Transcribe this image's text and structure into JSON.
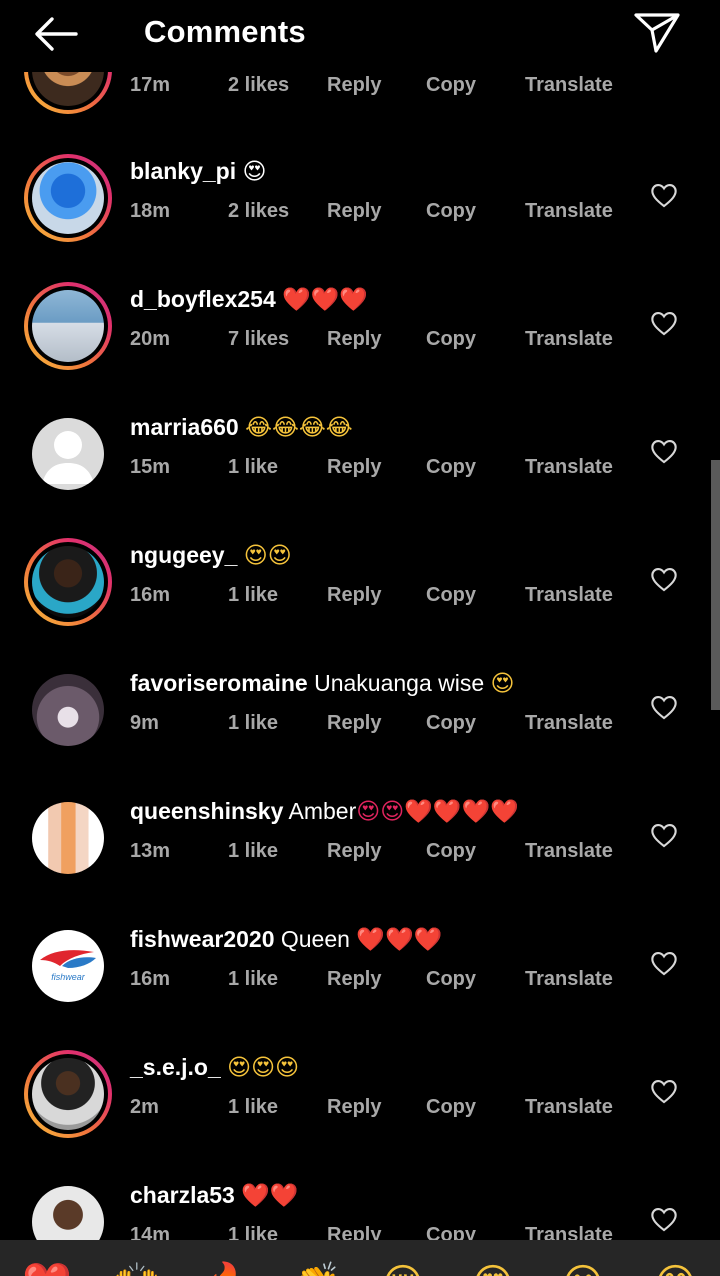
{
  "header": {
    "title": "Comments"
  },
  "comments": [
    {
      "username": "",
      "text": "",
      "emoji": "",
      "time": "17m",
      "likes": "2 likes",
      "reply": "Reply",
      "copy": "Copy",
      "translate": "Translate"
    },
    {
      "username": "blanky_pi",
      "text": "",
      "emoji": "😍",
      "time": "18m",
      "likes": "2 likes",
      "reply": "Reply",
      "copy": "Copy",
      "translate": "Translate"
    },
    {
      "username": "d_boyflex254",
      "text": "",
      "emoji": "❤️❤️❤️",
      "time": "20m",
      "likes": "7 likes",
      "reply": "Reply",
      "copy": "Copy",
      "translate": "Translate"
    },
    {
      "username": "marria660",
      "text": "",
      "emoji": "😂😂😂😂",
      "time": "15m",
      "likes": "1 like",
      "reply": "Reply",
      "copy": "Copy",
      "translate": "Translate"
    },
    {
      "username": "ngugeey_",
      "text": "",
      "emoji": "😍😍",
      "time": "16m",
      "likes": "1 like",
      "reply": "Reply",
      "copy": "Copy",
      "translate": "Translate"
    },
    {
      "username": "favoriseromaine",
      "text": "Unakuanga wise",
      "emoji": "😍",
      "time": "9m",
      "likes": "1 like",
      "reply": "Reply",
      "copy": "Copy",
      "translate": "Translate"
    },
    {
      "username": "queenshinsky",
      "text": "Amber",
      "emoji": "😍😍❤️❤️❤️❤️",
      "time": "13m",
      "likes": "1 like",
      "reply": "Reply",
      "copy": "Copy",
      "translate": "Translate"
    },
    {
      "username": "fishwear2020",
      "text": "Queen",
      "emoji": "❤️❤️❤️",
      "time": "16m",
      "likes": "1 like",
      "reply": "Reply",
      "copy": "Copy",
      "translate": "Translate"
    },
    {
      "username": "_s.e.j.o_",
      "text": "",
      "emoji": "😍😍😍",
      "time": "2m",
      "likes": "1 like",
      "reply": "Reply",
      "copy": "Copy",
      "translate": "Translate"
    },
    {
      "username": "charzla53",
      "text": "",
      "emoji": "❤️❤️",
      "time": "14m",
      "likes": "1 like",
      "reply": "Reply",
      "copy": "Copy",
      "translate": "Translate"
    }
  ],
  "fishwear_logo_text": "fishwear",
  "reactions": [
    "❤️",
    "🙌",
    "🔥",
    "👏",
    "😢",
    "😍",
    "😮",
    "😂"
  ],
  "colors": {
    "background": "#000000",
    "meta_text": "#a8a8a8",
    "heart": "#e0245e",
    "reaction_bar": "#262626"
  }
}
